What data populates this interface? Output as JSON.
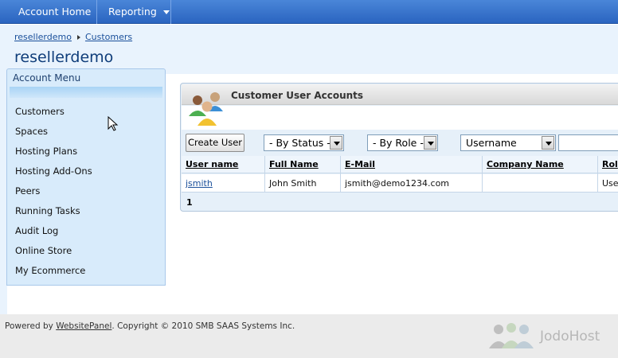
{
  "nav": {
    "items": [
      {
        "label": "Account Home"
      },
      {
        "label": "Reporting",
        "has_dropdown": true
      }
    ]
  },
  "breadcrumb": [
    "resellerdemo",
    "Customers"
  ],
  "header": {
    "title": "resellerdemo"
  },
  "account_menu": {
    "title": "Account Menu",
    "items": [
      "Customers",
      "Spaces",
      "Hosting Plans",
      "Hosting Add-Ons",
      "Peers",
      "Running Tasks",
      "Audit Log",
      "Online Store",
      "My Ecommerce"
    ]
  },
  "panel": {
    "title": "Customer User Accounts",
    "create_button": "Create User",
    "status_filter": "- By Status -",
    "role_filter": "- By Role -",
    "search_field": "Username",
    "search_value": ""
  },
  "table": {
    "columns": [
      "User name",
      "Full Name",
      "E-Mail",
      "Company Name",
      "Rol"
    ],
    "rows": [
      {
        "username": "jsmith",
        "full_name": "John Smith",
        "email": "jsmith@demo1234.com",
        "company": "",
        "role": "User"
      }
    ],
    "page": "1"
  },
  "footer": {
    "prefix": "Powered by ",
    "link": "WebsitePanel",
    "suffix": ". Copyright © 2010 SMB SAAS Systems Inc.",
    "logo_text": "JodoHost"
  },
  "colors": {
    "nav_blue": "#2a64c0",
    "header_bg": "#e9f3fd",
    "menu_bg": "#d8ebfb"
  }
}
